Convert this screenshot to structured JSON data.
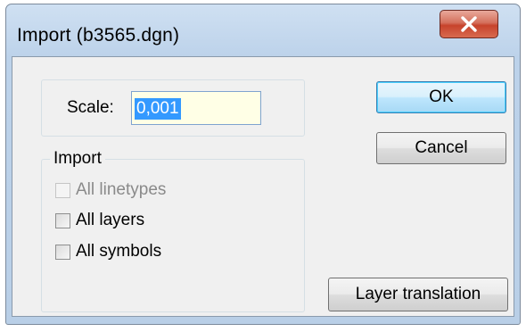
{
  "window": {
    "title": "Import (b3565.dgn)",
    "close_glyph": "x"
  },
  "scale": {
    "label": "Scale:",
    "value": "0,001"
  },
  "import_group": {
    "legend": "Import",
    "options": [
      {
        "label": "All linetypes",
        "checked": false,
        "enabled": false
      },
      {
        "label": "All layers",
        "checked": false,
        "enabled": true
      },
      {
        "label": "All symbols",
        "checked": false,
        "enabled": true
      }
    ]
  },
  "buttons": {
    "ok": "OK",
    "cancel": "Cancel",
    "layer_translation": "Layer translation"
  },
  "colors": {
    "title_bar": "#bcd2ea",
    "close_button": "#c7432c",
    "dialog_face": "#f0f0f0",
    "selection": "#3399ff",
    "input_background": "#ffffe6"
  }
}
